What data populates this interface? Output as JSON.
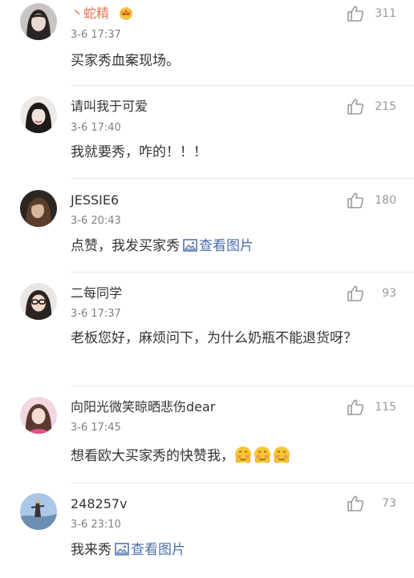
{
  "comments": [
    {
      "username": "丶蛇精",
      "timestamp": "3-6 17:37",
      "likes": "311",
      "text": "买家秀血案现场。",
      "badge_icon": "crown-badge-icon"
    },
    {
      "username": "请叫我于可爱",
      "timestamp": "3-6 17:40",
      "likes": "215",
      "text": "我就要秀，咋的！！！"
    },
    {
      "username": "JESSIE6",
      "timestamp": "3-6 20:43",
      "likes": "180",
      "text": "点赞，我发买家秀",
      "link_text": "查看图片",
      "link_icon": "image-icon"
    },
    {
      "username": "二每同学",
      "timestamp": "3-6 17:37",
      "likes": "93",
      "text": "老板您好，麻烦问下，为什么奶瓶不能退货呀？"
    },
    {
      "username": "向阳光微笑晾晒悲伤dear",
      "timestamp": "3-6 17:45",
      "likes": "115",
      "text": "想看欧大买家秀的快赞我，",
      "emoji_icons": [
        "blush-emoji-icon",
        "blush-emoji-icon",
        "blush-emoji-icon"
      ]
    },
    {
      "username": "248257v",
      "timestamp": "3-6 23:10",
      "likes": "73",
      "text": "我来秀",
      "link_text": "查看图片",
      "link_icon": "image-icon"
    }
  ],
  "colors": {
    "username_highlight": "#eb7350",
    "link": "#4a6ea9",
    "meta": "#808080",
    "like_count": "#999999"
  }
}
